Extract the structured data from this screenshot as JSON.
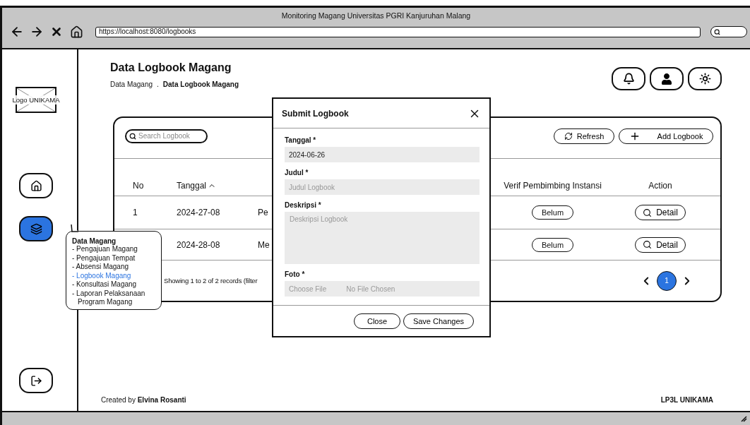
{
  "browser": {
    "title": "Monitoring Magang Universitas PGRI Kanjuruhan Malang",
    "url": "https://localhost:8080/logbooks"
  },
  "sidebar": {
    "logo": "Logo UNIKAMA",
    "nav": [
      {
        "selected": false
      },
      {
        "selected": true
      }
    ]
  },
  "submenu": {
    "title": "Data Magang",
    "items": [
      {
        "label": "- Pengajuan Magang",
        "selected": false
      },
      {
        "label": "- Pengajuan Tempat",
        "selected": false
      },
      {
        "label": "- Absensi Magang",
        "selected": false
      },
      {
        "label": "- Logbook Magang",
        "selected": true
      },
      {
        "label": "- Konsultasi Magang",
        "selected": false
      },
      {
        "label": "- Laporan Pelaksanaan Program Magang",
        "selected": false
      }
    ]
  },
  "page": {
    "title": "Data Logbook Magang",
    "breadcrumb": {
      "parent": "Data Magang",
      "separator": ".",
      "current": "Data Logbook Magang"
    }
  },
  "table_card": {
    "search_placeholder": "Search Logbook",
    "buttons": [
      {
        "kind": "refresh",
        "label": "Refresh"
      },
      {
        "kind": "add",
        "label": "Add Logbook"
      }
    ],
    "columns": [
      {
        "label": "No"
      },
      {
        "label": "Tanggal",
        "sorted": true
      },
      {},
      {
        "label": "Verif Pembimbing Instansi"
      },
      {
        "label": "Action"
      }
    ],
    "rows": [
      {
        "no": "1",
        "tanggal": "2024-27-08",
        "column_3": "Pe",
        "verif": "Belum",
        "action": "Detail"
      },
      {
        "tanggal": "2024-28-08",
        "column_3": "Me",
        "verif": "Belum",
        "action": "Detail"
      }
    ],
    "info": "Showing 1 to 2 of 2 records (filter",
    "pagination": [
      {
        "label": "1",
        "selected": true
      }
    ]
  },
  "modal": {
    "title": "Submit Logbook",
    "fields": [
      {
        "kind": "text",
        "label": "Tanggal *",
        "value": "2024-06-26"
      },
      {
        "kind": "text",
        "label": "Judul *",
        "placeholder": "Judul Logbook"
      },
      {
        "kind": "textarea",
        "label": "Deskripsi *",
        "placeholder": "Deskripsi Logbook"
      },
      {
        "kind": "file",
        "label": "Foto *",
        "button": "Choose File",
        "status": "No File Chosen"
      }
    ],
    "buttons": [
      "Close",
      "Save Changes"
    ]
  },
  "footer": {
    "credit": "Created by **Elvina Rosanti**",
    "brand": "LP3L UNIKAMA"
  }
}
